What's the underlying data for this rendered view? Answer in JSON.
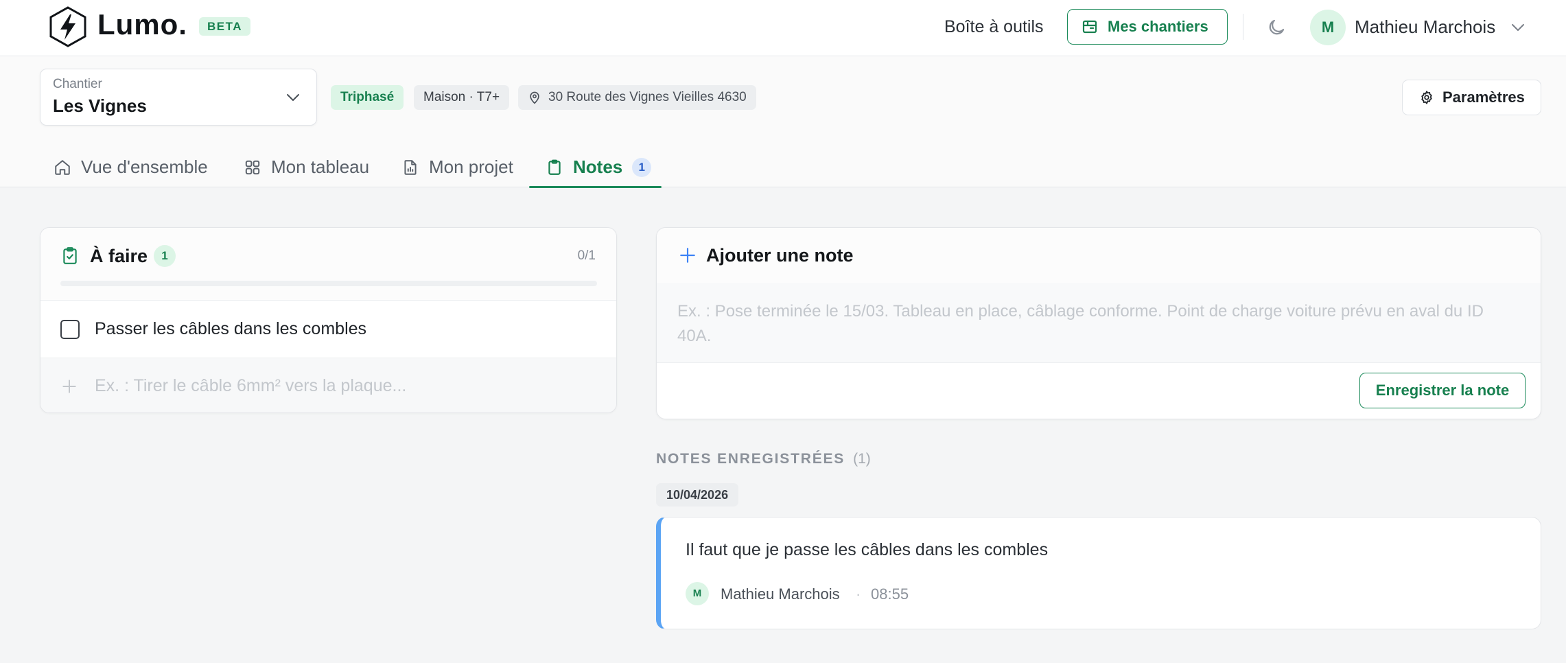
{
  "brand": {
    "name": "Lumo.",
    "badge": "BETA"
  },
  "header": {
    "toolbox_link": "Boîte à outils",
    "my_sites_button": "Mes chantiers",
    "user": {
      "initial": "M",
      "name": "Mathieu Marchois"
    }
  },
  "site": {
    "label": "Chantier",
    "name": "Les Vignes",
    "tags": {
      "phase": "Triphasé",
      "type": "Maison · T7+",
      "address": "30 Route des Vignes Vieilles 4630"
    },
    "settings_button": "Paramètres"
  },
  "tabs": [
    {
      "label": "Vue d'ensemble",
      "icon": "home-icon"
    },
    {
      "label": "Mon tableau",
      "icon": "grid-icon"
    },
    {
      "label": "Mon projet",
      "icon": "document-icon"
    },
    {
      "label": "Notes",
      "icon": "clipboard-icon",
      "count": "1",
      "active": true
    }
  ],
  "todo": {
    "title": "À faire",
    "count": "1",
    "progress_label": "0/1",
    "progress_fraction": 0,
    "items": [
      {
        "label": "Passer les câbles dans les combles",
        "checked": false
      }
    ],
    "add_placeholder": "Ex. : Tirer le câble 6mm² vers la plaque..."
  },
  "add_note": {
    "title": "Ajouter une note",
    "placeholder": "Ex. : Pose terminée le 15/03. Tableau en place, câblage conforme. Point de charge voiture prévu en aval du ID 40A.",
    "save_button": "Enregistrer la note"
  },
  "saved_notes": {
    "title": "NOTES ENREGISTRÉES",
    "count": "(1)",
    "groups": [
      {
        "date": "10/04/2026",
        "notes": [
          {
            "text": "Il faut que je passe les câbles dans les combles",
            "author_initial": "M",
            "author": "Mathieu Marchois",
            "separator": "·",
            "time": "08:55"
          }
        ]
      }
    ]
  },
  "colors": {
    "accent": "#1b8a5a",
    "accent_light": "#dcf5e6",
    "note_border": "#5ba4f4",
    "badge_blue_bg": "#dbe7fb",
    "badge_blue_fg": "#2b5fc7"
  }
}
